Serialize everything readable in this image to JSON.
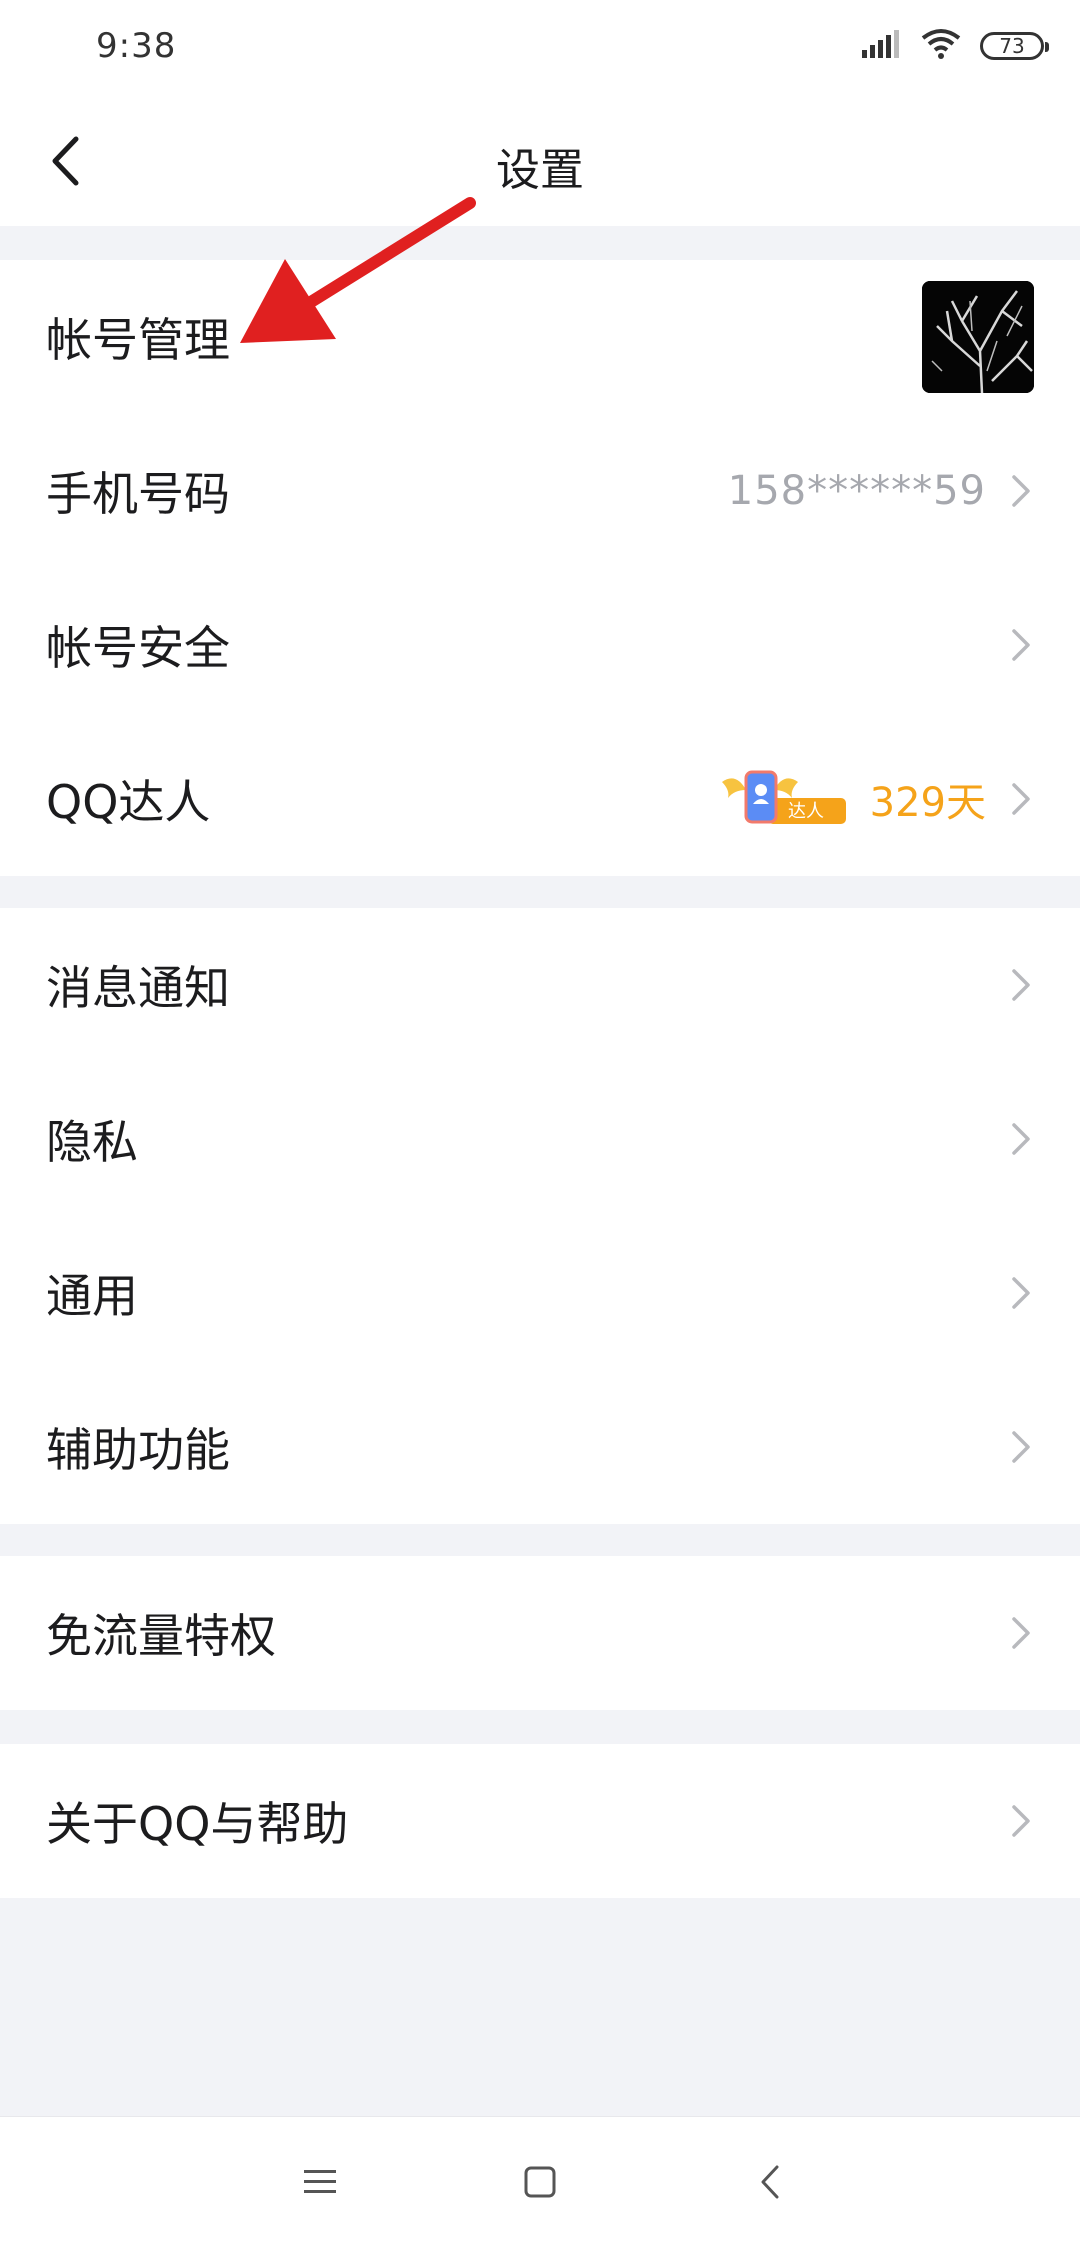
{
  "status_bar": {
    "time": "9:38",
    "battery": "73",
    "icons": [
      "signal-icon",
      "wifi-icon",
      "battery-icon"
    ]
  },
  "header": {
    "title": "设置",
    "back_icon": "back-arrow-icon"
  },
  "groups": [
    {
      "items": [
        {
          "label": "帐号管理",
          "right": "avatar"
        },
        {
          "label": "手机号码",
          "value": "158******59"
        },
        {
          "label": "帐号安全"
        },
        {
          "label": "QQ达人",
          "badge_text": "达人",
          "value": "329天"
        }
      ]
    },
    {
      "items": [
        {
          "label": "消息通知"
        },
        {
          "label": "隐私"
        },
        {
          "label": "通用"
        },
        {
          "label": "辅助功能"
        }
      ]
    },
    {
      "items": [
        {
          "label": "免流量特权"
        }
      ]
    },
    {
      "items": [
        {
          "label": "关于QQ与帮助"
        }
      ]
    }
  ],
  "system_nav": {
    "icons": [
      "menu-icon",
      "home-icon",
      "back-icon"
    ]
  },
  "colors": {
    "background": "#f2f3f7",
    "card": "#ffffff",
    "value_gray": "#a6a8ae",
    "value_orange": "#f5a31a",
    "annotation_red": "#e02020"
  }
}
